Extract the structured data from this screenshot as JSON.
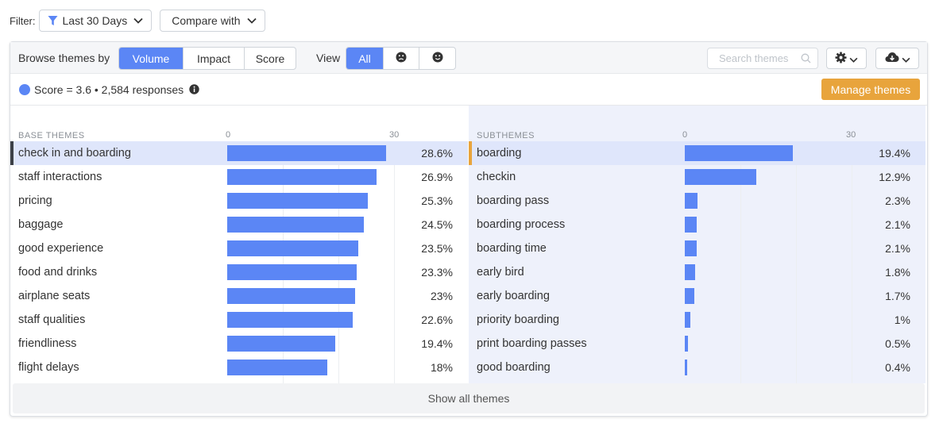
{
  "filter": {
    "label": "Filter:",
    "date_range": "Last 30 Days",
    "compare_label": "Compare with"
  },
  "toolbar": {
    "browse_label": "Browse themes by",
    "browse_options": [
      "Volume",
      "Impact",
      "Score"
    ],
    "browse_active": "Volume",
    "view_label": "View",
    "view_options": [
      {
        "label": "All",
        "icon": "all"
      },
      {
        "label": "",
        "icon": "sad-face-icon"
      },
      {
        "label": "",
        "icon": "happy-face-icon"
      }
    ],
    "view_active": "All",
    "search_placeholder": "Search themes"
  },
  "summary": {
    "text": "Score = 3.6 • 2,584 responses",
    "manage_label": "Manage themes"
  },
  "base_themes": {
    "header": "BASE THEMES",
    "axis_min_label": "0",
    "axis_max_label": "30",
    "axis_max": 30,
    "rows": [
      {
        "name": "check in and boarding",
        "value": 28.6,
        "label": "28.6%",
        "selected": true
      },
      {
        "name": "staff interactions",
        "value": 26.9,
        "label": "26.9%"
      },
      {
        "name": "pricing",
        "value": 25.3,
        "label": "25.3%"
      },
      {
        "name": "baggage",
        "value": 24.5,
        "label": "24.5%"
      },
      {
        "name": "good experience",
        "value": 23.5,
        "label": "23.5%"
      },
      {
        "name": "food and drinks",
        "value": 23.3,
        "label": "23.3%"
      },
      {
        "name": "airplane seats",
        "value": 23,
        "label": "23%"
      },
      {
        "name": "staff qualities",
        "value": 22.6,
        "label": "22.6%"
      },
      {
        "name": "friendliness",
        "value": 19.4,
        "label": "19.4%"
      },
      {
        "name": "flight delays",
        "value": 18,
        "label": "18%"
      }
    ]
  },
  "subthemes": {
    "header": "SUBTHEMES",
    "axis_min_label": "0",
    "axis_max_label": "30",
    "axis_max": 30,
    "rows": [
      {
        "name": "boarding",
        "value": 19.4,
        "label": "19.4%",
        "selected": true
      },
      {
        "name": "checkin",
        "value": 12.9,
        "label": "12.9%"
      },
      {
        "name": "boarding pass",
        "value": 2.3,
        "label": "2.3%"
      },
      {
        "name": "boarding process",
        "value": 2.1,
        "label": "2.1%"
      },
      {
        "name": "boarding time",
        "value": 2.1,
        "label": "2.1%"
      },
      {
        "name": "early bird",
        "value": 1.8,
        "label": "1.8%"
      },
      {
        "name": "early boarding",
        "value": 1.7,
        "label": "1.7%"
      },
      {
        "name": "priority boarding",
        "value": 1,
        "label": "1%"
      },
      {
        "name": "print boarding passes",
        "value": 0.5,
        "label": "0.5%"
      },
      {
        "name": "good boarding",
        "value": 0.4,
        "label": "0.4%"
      }
    ]
  },
  "footer": {
    "show_all_label": "Show all themes"
  },
  "colors": {
    "accent": "#5b86f5",
    "manage": "#e8a43c",
    "left_marker": "#3d4148",
    "right_marker": "#e8a43c"
  }
}
